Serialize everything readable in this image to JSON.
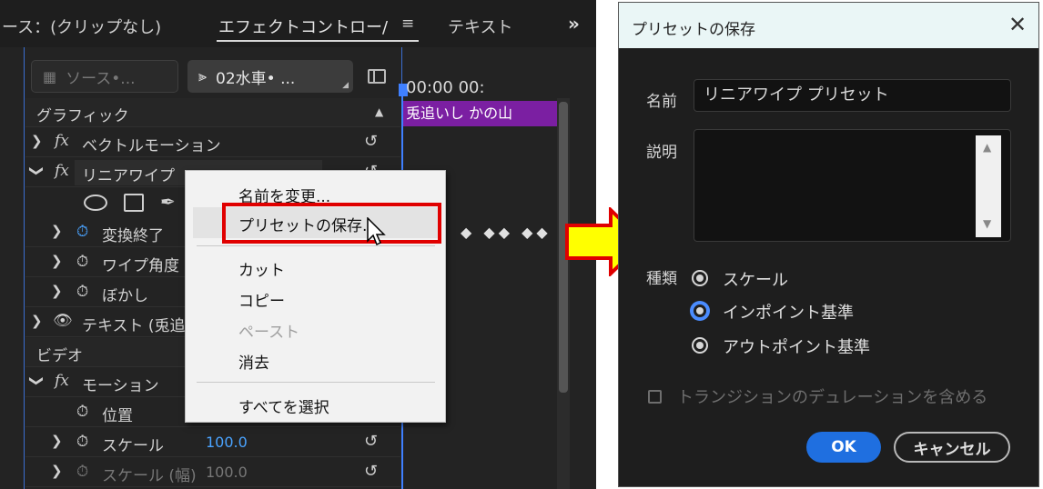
{
  "left_panel": {
    "tabs": {
      "source": "ース：(クリップなし)",
      "effect_controls": "エフェクトコントロー/",
      "menu_icon": "≡",
      "text": "テキスト",
      "overflow_icon": "»"
    },
    "source_pill": "ソース•...",
    "sequence_pill": "02水車• ...",
    "timeline_time": "00:00       00:",
    "clip_name": "兎追いし かの山",
    "rows": {
      "graphics": "グラフィック",
      "vector_motion": "ベクトルモーション",
      "linear_wipe": "リニアワイプ",
      "transition_completion": "変換終了",
      "wipe_angle": "ワイプ角度",
      "feather": "ぼかし",
      "text": "テキスト (兎追",
      "video": "ビデオ",
      "motion": "モーション",
      "position": "位置",
      "scale": "スケール",
      "scale_value": "100.0",
      "scale_width": "スケール (幅)",
      "scale_width_value": "100.0"
    },
    "keyframes": "◆ ◆◆  ◆◆"
  },
  "context_menu": {
    "rename": "名前を変更...",
    "save_preset": "プリセットの保存...",
    "cut": "カット",
    "copy": "コピー",
    "paste": "ペースト",
    "clear": "消去",
    "select_all": "すべてを選択"
  },
  "dialog": {
    "title": "プリセットの保存",
    "name_label": "名前",
    "name_value": "リニアワイプ プリセット",
    "description_label": "説明",
    "description_value": "",
    "kind_label": "種類",
    "radio_scale": "スケール",
    "radio_in_point": "インポイント基準",
    "radio_out_point": "アウトポイント基準",
    "selected_radio": "インポイント基準",
    "checkbox_label": "トランジションのデュレーションを含める",
    "ok": "OK",
    "cancel": "キャンセル"
  },
  "colors": {
    "accent_blue": "#3f80ff",
    "clip_purple": "#7b1fa2",
    "highlight_red": "#e00000",
    "arrow_yellow": "#ffff00"
  }
}
